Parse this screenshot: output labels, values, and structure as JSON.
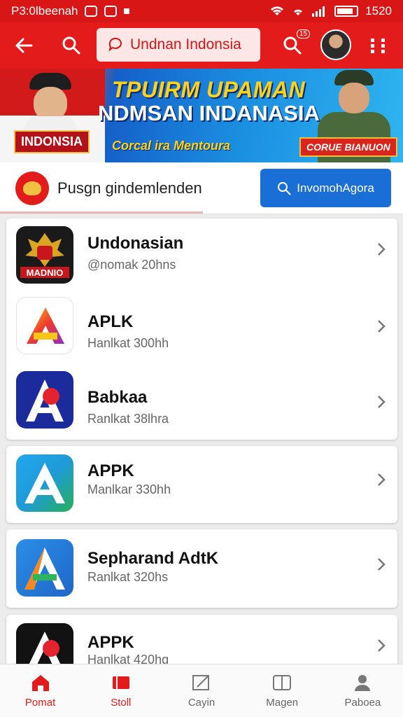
{
  "status_bar": {
    "left_text": "P3:0lbeenah",
    "time": "1520"
  },
  "app_bar": {
    "search_text": "Undnan Indonsia",
    "notification_badge": "15"
  },
  "banner": {
    "headline_1": "TPUIRM UPAMAN",
    "headline_2": "NDMSAN INDANASIA",
    "subline": "Corcal ira Mentoura",
    "label_left": "INDONSIA",
    "label_right": "CORUE BIANUON"
  },
  "sub_header": {
    "title": "Pusgn gindemlenden",
    "button_label": "InvomohAgora"
  },
  "apps": [
    {
      "name": "Undonasian",
      "sub": "@nomak 20hns",
      "icon": "garuda-icon",
      "icon_text": "MADNIO"
    },
    {
      "name": "APLK",
      "sub": "Hanlkat 300hh",
      "icon": "a-gradient-icon"
    },
    {
      "name": "Babkaa",
      "sub": "Ranlkat 38lhra",
      "icon": "a-red-blue-icon"
    },
    {
      "name": "APPK",
      "sub": "Manlkar 330hh",
      "icon": "a-blue-green-icon"
    },
    {
      "name": "Sepharand AdtK",
      "sub": "Ranlkat 320hs",
      "icon": "a-orange-blue-icon"
    },
    {
      "name": "APPK",
      "sub": "Hanlkat 420hg",
      "icon": "a-red-black-icon"
    }
  ],
  "bottom_nav": [
    {
      "label": "Pomat",
      "icon": "home-icon",
      "active": true
    },
    {
      "label": "Stoll",
      "icon": "square-icon",
      "active": false
    },
    {
      "label": "Cayin",
      "icon": "edit-icon",
      "active": false
    },
    {
      "label": "Magen",
      "icon": "book-icon",
      "active": false
    },
    {
      "label": "Paboea",
      "icon": "person-icon",
      "active": false
    }
  ],
  "colors": {
    "primary_red": "#e31b1b",
    "info_blue": "#1a6fd6"
  }
}
